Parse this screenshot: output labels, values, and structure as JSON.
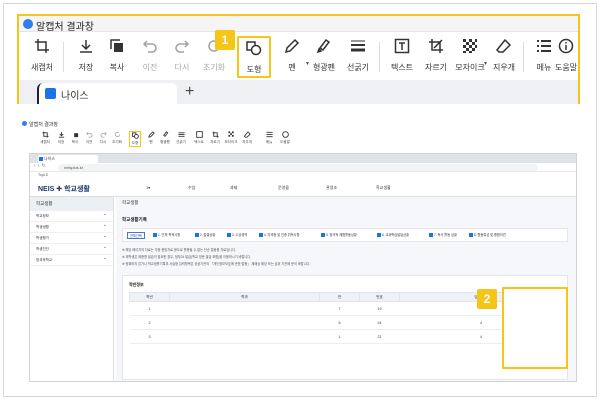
{
  "zoom": {
    "app_title": "알캡처 결과창",
    "toolbar": [
      {
        "key": "new",
        "label": "새캡처",
        "icon": "crop-icon",
        "dim": false
      },
      {
        "key": "save",
        "label": "저장",
        "icon": "download-icon",
        "dim": false
      },
      {
        "key": "copy",
        "label": "복사",
        "icon": "copy-icon",
        "dim": false
      },
      {
        "key": "undo",
        "label": "이전",
        "icon": "undo-icon",
        "dim": true
      },
      {
        "key": "redo",
        "label": "다시",
        "icon": "redo-icon",
        "dim": true
      },
      {
        "key": "reset",
        "label": "초기화",
        "icon": "reset-icon",
        "dim": true
      },
      {
        "key": "shape",
        "label": "도형",
        "icon": "shapes-icon",
        "dim": false
      },
      {
        "key": "pen",
        "label": "펜",
        "icon": "pen-icon",
        "dim": false
      },
      {
        "key": "highlighter",
        "label": "형광펜",
        "icon": "highlighter-icon",
        "dim": false
      },
      {
        "key": "linewidth",
        "label": "선굵기",
        "icon": "line-width-icon",
        "dim": false
      },
      {
        "key": "text",
        "label": "텍스트",
        "icon": "text-icon",
        "dim": false
      },
      {
        "key": "crop",
        "label": "자르기",
        "icon": "crop-tool-icon",
        "dim": false
      },
      {
        "key": "mosaic",
        "label": "모자이크",
        "icon": "mosaic-icon",
        "dim": false
      },
      {
        "key": "eraser",
        "label": "지우개",
        "icon": "eraser-icon",
        "dim": false
      },
      {
        "key": "menu",
        "label": "메뉴",
        "icon": "list-icon",
        "dim": false
      },
      {
        "key": "help",
        "label": "도움말",
        "icon": "info-icon",
        "dim": false
      }
    ],
    "badge1": "1",
    "tab_title": "나이스",
    "new_tab": "+"
  },
  "mini": {
    "app_title": "알캡처 결과창",
    "tab_title": "나이스",
    "url": "neisplus.kr",
    "bookmark": "TopLS",
    "logo": "NEIS ✚ 학교생활",
    "menu": [
      "1▾",
      "수업",
      "과제",
      "운영을",
      "관생조",
      "학교생활"
    ],
    "sidebar_head": "학교생활",
    "sidebar_items": [
      "학교정보",
      "학생생활",
      "학생평가",
      "학생진단",
      "방과후학교"
    ],
    "crumb": "학교생활",
    "section_title": "학교생활기록",
    "filters": [
      "전체선택",
      "1. 인적·학적사항",
      "2. 출결상황",
      "3. 수상경력",
      "4. 자격증 및 인증 취득사항",
      "5. 창의적 체험활동상황",
      "6. 교과학습발달상황",
      "7. 독서 활동 상황",
      "8. 행동특성 및 종합의견"
    ],
    "notes": [
      "※ 해당 페이지의 자료는 각종 증빙자료 용도로 활용될 수 없는 단순 열람용 자료입니다.",
      "※ 재학생은 제증명 발급이 필요한 경우, 정부24 발급(학교 방문 발급 포함)을 이용하시기 바랍니다.",
      "※ 정확하지 않거나 학교생활기록부 서술형 입력항목은 공공기관의 「개인정보보호에 관한 법률」 제해상 해당 또는 상위 기관에 문의 바랍니다."
    ],
    "table_title": "학반정보",
    "table_headers": [
      "학년",
      "학과",
      "반",
      "번호",
      "담임성명"
    ],
    "table_rows": [
      [
        "1",
        "",
        "7",
        "19",
        ""
      ],
      [
        "2",
        "",
        "6",
        "24",
        "4"
      ],
      [
        "3",
        "",
        "1",
        "21",
        "4"
      ]
    ]
  },
  "badge2": "2"
}
